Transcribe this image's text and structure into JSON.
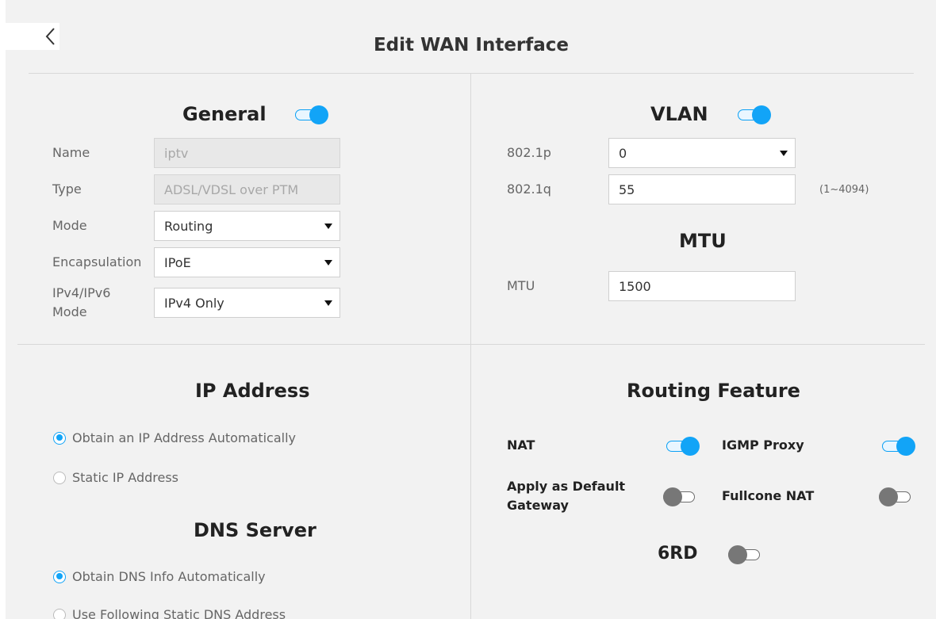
{
  "header": {
    "title": "Edit WAN Interface",
    "back_icon": "chevron-left-icon"
  },
  "general": {
    "title": "General",
    "enabled": true,
    "fields": {
      "name": {
        "label": "Name",
        "value": "iptv"
      },
      "type": {
        "label": "Type",
        "value": "ADSL/VDSL over PTM"
      },
      "mode": {
        "label": "Mode",
        "value": "Routing"
      },
      "encapsulation": {
        "label": "Encapsulation",
        "value": "IPoE"
      },
      "ip_mode": {
        "label_line1": "IPv4/IPv6",
        "label_line2": "Mode",
        "value": "IPv4 Only"
      }
    }
  },
  "vlan": {
    "title": "VLAN",
    "enabled": true,
    "p8021": {
      "label": "802.1p",
      "value": "0"
    },
    "q8021": {
      "label": "802.1q",
      "value": "55",
      "hint": "(1~4094)"
    }
  },
  "mtu": {
    "title": "MTU",
    "label": "MTU",
    "value": "1500"
  },
  "ip_address": {
    "title": "IP Address",
    "options": [
      {
        "label": "Obtain an IP Address Automatically",
        "checked": true
      },
      {
        "label": "Static IP Address",
        "checked": false
      }
    ]
  },
  "dns": {
    "title": "DNS Server",
    "options": [
      {
        "label": "Obtain DNS Info Automatically",
        "checked": true
      },
      {
        "label": "Use Following Static DNS Address",
        "checked": false
      }
    ]
  },
  "routing": {
    "title": "Routing Feature",
    "nat": {
      "label": "NAT",
      "enabled": true
    },
    "igmp": {
      "label": "IGMP Proxy",
      "enabled": true
    },
    "default_gw": {
      "label_line1": "Apply as Default",
      "label_line2": "Gateway",
      "enabled": false
    },
    "fullcone": {
      "label": "Fullcone NAT",
      "enabled": false
    },
    "sixrd": {
      "label": "6RD",
      "enabled": false
    }
  },
  "colors": {
    "accent": "#12a4f7",
    "toggle_off": "#777777",
    "background": "#f2f2f2"
  }
}
